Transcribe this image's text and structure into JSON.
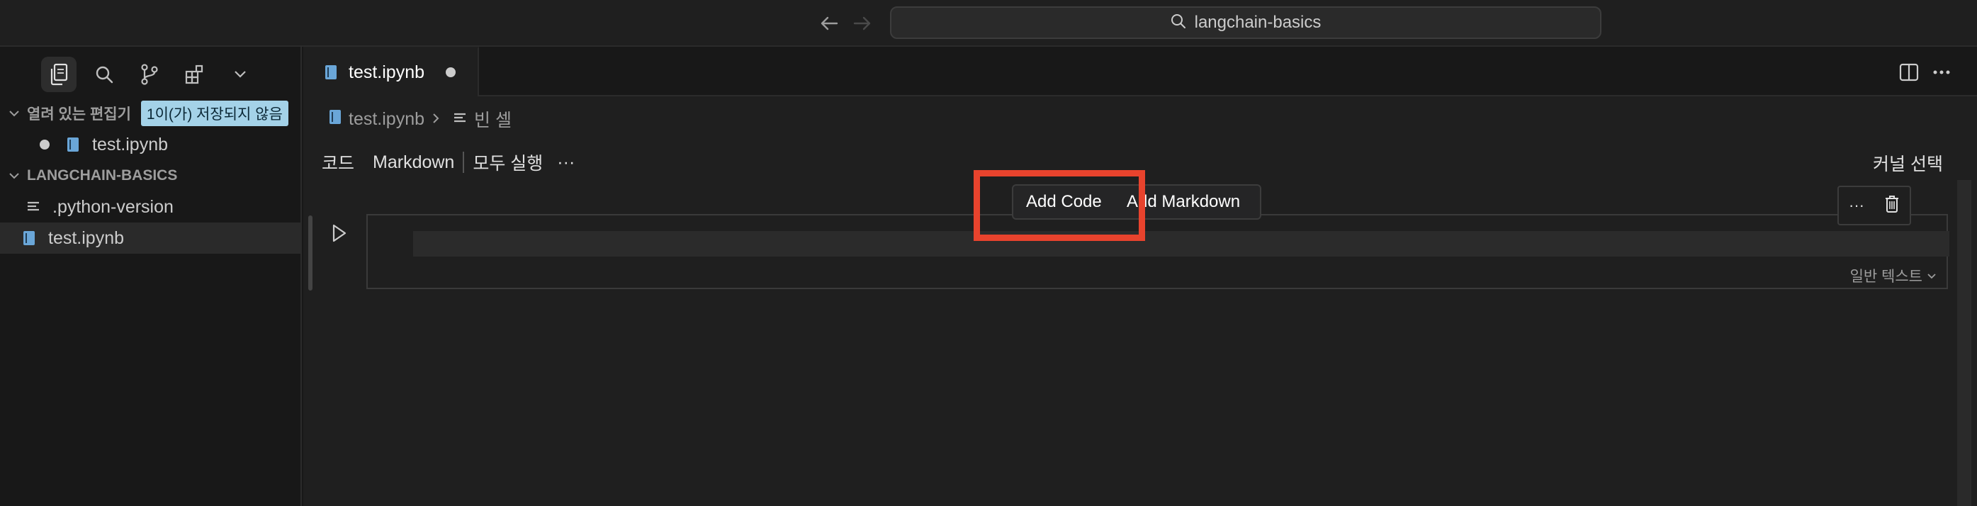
{
  "titlebar": {
    "search_text": "langchain-basics",
    "back_icon": "arrow-left-icon",
    "forward_icon": "arrow-right-icon"
  },
  "sidebar": {
    "activity_icons": [
      "explorer-icon",
      "search-icon",
      "source-control-icon",
      "extensions-icon",
      "chevron-down-icon"
    ],
    "open_editors": {
      "title": "열려 있는 편집기",
      "badge": "1이(가) 저장되지 않음",
      "items": [
        {
          "label": "test.ipynb",
          "dirty": true
        }
      ]
    },
    "workspace": {
      "title": "LANGCHAIN-BASICS",
      "items": [
        {
          "label": ".python-version",
          "icon": "lines-icon"
        },
        {
          "label": "test.ipynb",
          "icon": "notebook-icon",
          "selected": true
        }
      ]
    }
  },
  "editor": {
    "tab": {
      "label": "test.ipynb",
      "dirty": true
    },
    "breadcrumb": {
      "file": "test.ipynb",
      "section": "빈 셀"
    },
    "toolbar": {
      "code": "코드",
      "markdown": "Markdown",
      "run_all": "모두 실행",
      "more": "···"
    },
    "kernel": "커널 선택",
    "insert_popup": {
      "add_code": "Add Code",
      "add_markdown": "Add Markdown"
    },
    "cell": {
      "language": "일반 텍스트"
    },
    "cell_tools": {
      "more": "···"
    }
  },
  "colors": {
    "accent_highlight": "#e8432d",
    "badge_bg": "#a4d2e8",
    "notebook_icon": "#6aa6d8"
  }
}
